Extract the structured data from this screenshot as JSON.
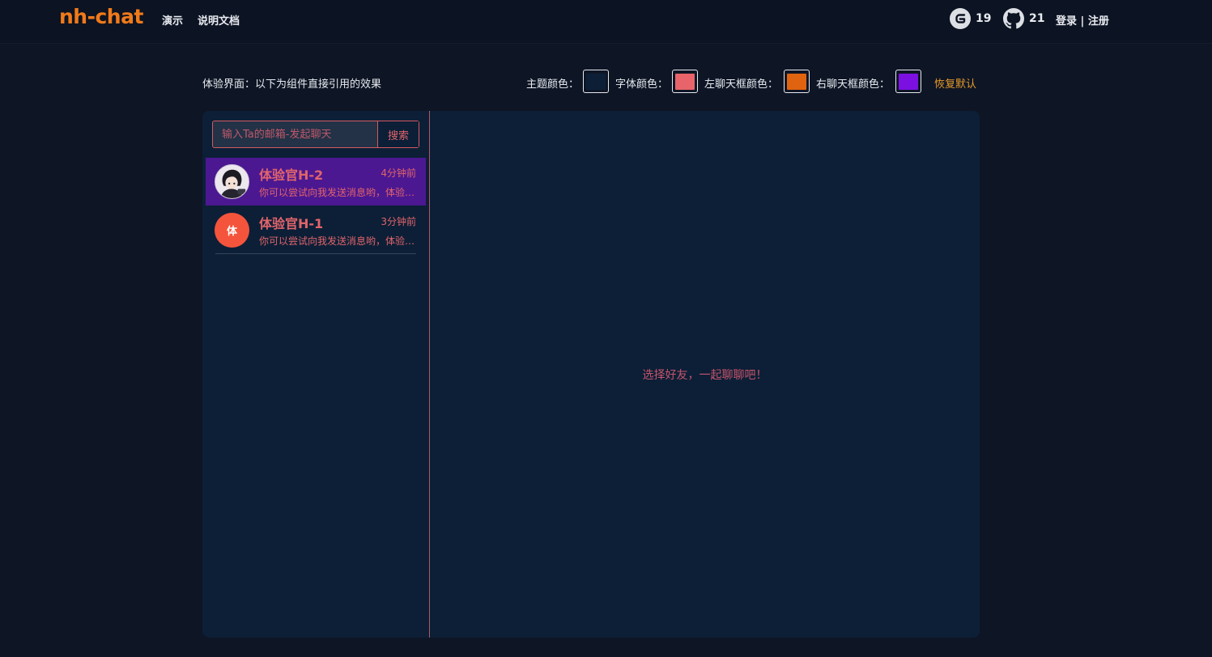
{
  "header": {
    "brand": "nh-chat",
    "nav": [
      "演示",
      "说明文档"
    ],
    "gitee_count": "19",
    "github_count": "21",
    "login": "登录",
    "separator": " | ",
    "register": "注册"
  },
  "toolbar": {
    "title": "体验界面：以下为组件直接引用的效果",
    "theme_label": "主题颜色：",
    "font_label": "字体颜色：",
    "left_bubble_label": "左聊天框颜色：",
    "right_bubble_label": "右聊天框颜色：",
    "reset": "恢复默认",
    "colors": {
      "theme": "#0c1f37",
      "font": "#e8646a",
      "left_bubble": "#e0630f",
      "right_bubble": "#7c10e0"
    }
  },
  "search": {
    "placeholder": "输入Ta的邮箱-发起聊天",
    "button": "搜索"
  },
  "contacts": [
    {
      "name": "体验官H-2",
      "time": "4分钟前",
      "message": "你可以尝试向我发送消息哟，体验一下吧",
      "avatar": "user-photo-avatar",
      "active": true
    },
    {
      "name": "体验官H-1",
      "time": "3分钟前",
      "message": "你可以尝试向我发送消息哟，体验一下吧",
      "avatar_letter": "体",
      "active": false
    }
  ],
  "chat": {
    "empty_hint": "选择好友，一起聊聊吧！"
  },
  "icons": [
    "gitee-icon",
    "github-icon"
  ]
}
